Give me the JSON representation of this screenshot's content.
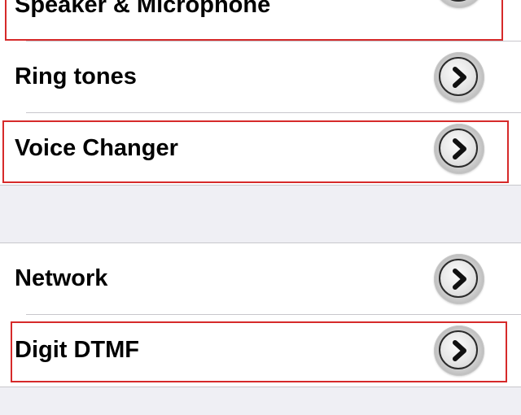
{
  "settings": {
    "group1": [
      {
        "label": "Speaker & Microphone",
        "highlighted": true
      },
      {
        "label": "Ring tones",
        "highlighted": false
      },
      {
        "label": "Voice Changer",
        "highlighted": true
      }
    ],
    "group2": [
      {
        "label": "Network",
        "highlighted": false
      },
      {
        "label": "Digit DTMF",
        "highlighted": true
      }
    ]
  },
  "icons": {
    "row_disclosure": "chevron-right-icon"
  },
  "colors": {
    "highlight": "#d62a2a",
    "background": "#efeff4",
    "separator": "#c8c7cc"
  }
}
